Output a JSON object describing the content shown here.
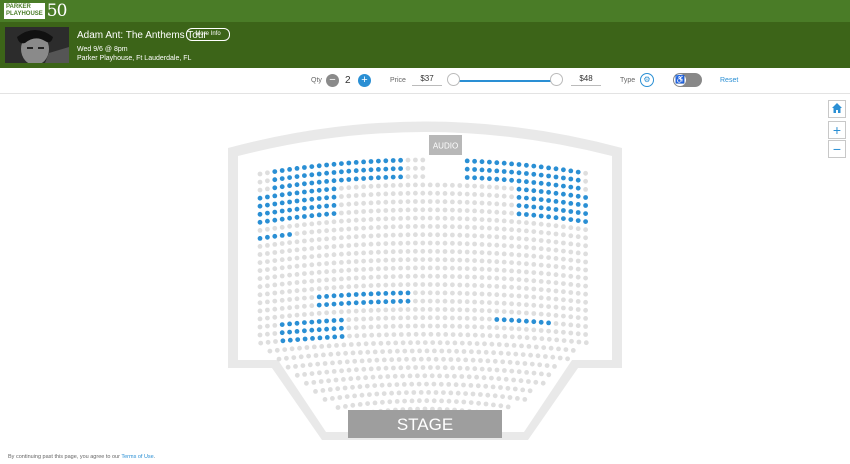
{
  "brand": {
    "logo_line1": "PARKER",
    "logo_line2": "PLAYHOUSE",
    "logo_number": "50"
  },
  "event": {
    "title": "Adam Ant: The Anthems Tour",
    "more_info_label": "More Info",
    "date": "Wed 9/6 @ 8pm",
    "venue": "Parker Playhouse, Ft Lauderdale, FL"
  },
  "filters": {
    "qty_label": "Qty",
    "qty_value": "2",
    "price_label": "Price",
    "price_min": "$37",
    "price_max": "$48",
    "type_label": "Type",
    "reset_label": "Reset",
    "price_min_fraction": 0.0,
    "price_max_fraction": 1.0
  },
  "map": {
    "audio_label": "AUDIO",
    "stage_label": "STAGE",
    "available_color": "#2a8fd4",
    "unavailable_color": "#dedede"
  },
  "controls": {
    "home": "home-icon",
    "zoom_in": "+",
    "zoom_out": "−"
  },
  "footer": {
    "text": "By continuing past this page, you agree to our ",
    "link": "Terms of Use",
    "end": "."
  },
  "colors": {
    "brand_green": "#4a7c27",
    "brand_dark_green": "#3c6418",
    "accent_blue": "#2a8fd4"
  }
}
